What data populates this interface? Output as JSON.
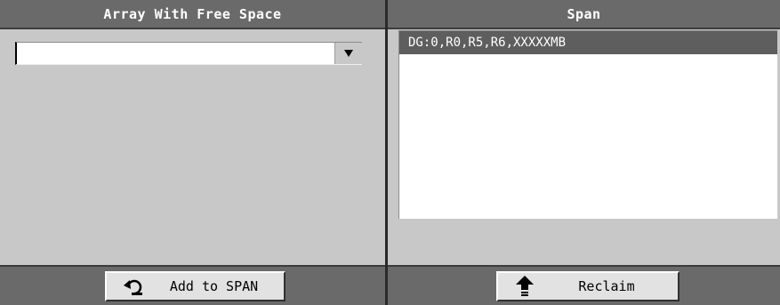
{
  "left_panel": {
    "title": "Array With Free Space",
    "dropdown": {
      "selected": "",
      "arrow_icon": "triangle-down-icon"
    },
    "add_button": {
      "label": "Add to SPAN",
      "icon": "undo-arrow-icon"
    }
  },
  "right_panel": {
    "title": "Span",
    "items": [
      {
        "label": "DG:0,R0,R5,R6,XXXXXMB",
        "selected": true
      }
    ],
    "reclaim_button": {
      "label": "Reclaim",
      "icon": "up-arrow-icon"
    }
  },
  "colors": {
    "background": "#c8c8c8",
    "header": "#6a6a6a",
    "selection": "#5e5e5e",
    "button_face": "#e2e2e2"
  }
}
